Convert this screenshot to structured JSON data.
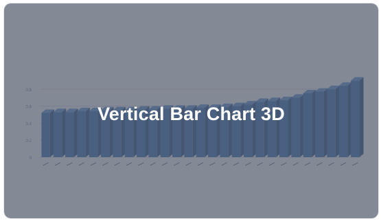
{
  "card": {
    "title": "Vertical Bar Chart 3D"
  },
  "colors": {
    "bar_front": "#2f6db3",
    "bar_side": "#1d4a80",
    "bar_top": "#5a8fd0",
    "overlay": "#545c6e",
    "grid": "#d7dbe2",
    "axis_text": "#6b7280"
  },
  "chart_data": {
    "type": "bar",
    "variant": "3d-vertical",
    "title": "",
    "xlabel": "",
    "ylabel": "",
    "ylim": [
      0,
      1.0
    ],
    "yticks": [
      "0",
      "0.2",
      "0.4",
      "0.6",
      "0.8"
    ],
    "grid": true,
    "categories": [
      "",
      "",
      "",
      "",
      "",
      "",
      "",
      "",
      "",
      "",
      "",
      "",
      "",
      "",
      "",
      "",
      "",
      "",
      "",
      "",
      "",
      "",
      "",
      "",
      "",
      ""
    ],
    "values": [
      0.52,
      0.53,
      0.53,
      0.54,
      0.54,
      0.55,
      0.55,
      0.55,
      0.56,
      0.56,
      0.57,
      0.57,
      0.57,
      0.58,
      0.58,
      0.59,
      0.6,
      0.62,
      0.65,
      0.66,
      0.67,
      0.7,
      0.75,
      0.77,
      0.8,
      0.84,
      0.9
    ]
  }
}
